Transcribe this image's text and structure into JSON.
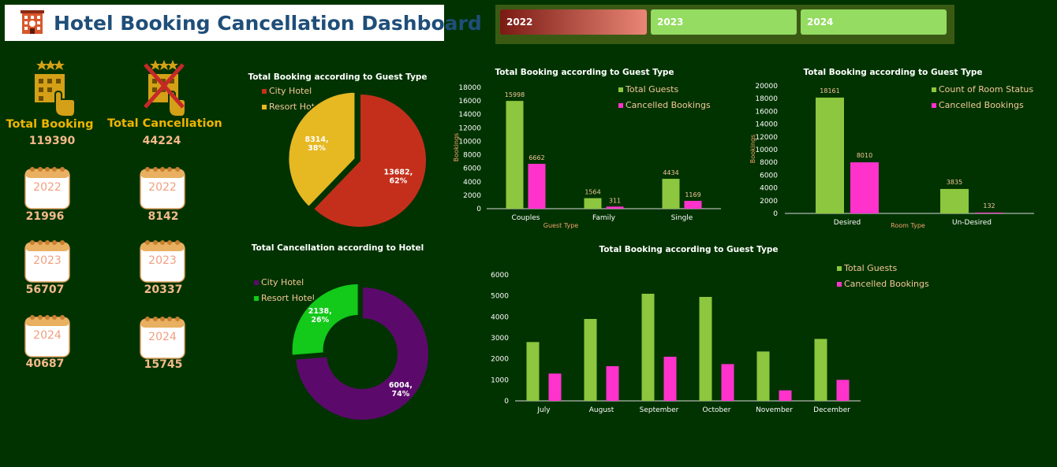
{
  "header": {
    "title": "Hotel Booking Cancellation Dashboard"
  },
  "slicer": {
    "years": [
      "2022",
      "2023",
      "2024"
    ],
    "selected": "2022"
  },
  "colors": {
    "background": "#013300",
    "accent_green": "#8dc63f",
    "accent_pink": "#ff33cc",
    "city_red": "#c42f1c",
    "resort_yellow": "#e6b822",
    "purple": "#5b0a6b",
    "bright_green": "#13c91a"
  },
  "kpi": {
    "total_booking": {
      "label": "Total Booking",
      "value": "119390",
      "icon": "hotel-building-icon"
    },
    "total_cancellation": {
      "label": "Total Cancellation",
      "value": "44224",
      "icon": "cancelled-hotel-icon"
    },
    "years": [
      {
        "year": "2022",
        "booking": "21996",
        "cancellation": "8142"
      },
      {
        "year": "2023",
        "booking": "56707",
        "cancellation": "20337"
      },
      {
        "year": "2024",
        "booking": "40687",
        "cancellation": "15745"
      }
    ]
  },
  "chart_data": [
    {
      "id": "pie-hotel",
      "type": "pie",
      "title": "Total Booking according to Guest Type",
      "labels": [
        "City Hotel",
        "Resort Hotel"
      ],
      "values": [
        13682,
        8314
      ],
      "data_labels": [
        "13682,\n62%",
        "8314,\n38%"
      ],
      "legend": "top-left"
    },
    {
      "id": "donut-cancel",
      "type": "pie",
      "title": "Total Cancellation according to Hotel",
      "labels": [
        "City Hotel",
        "Resort Hotel"
      ],
      "values": [
        6004,
        2138
      ],
      "data_labels": [
        "6004,\n74%",
        "2138,\n26%"
      ],
      "legend": "top-left"
    },
    {
      "id": "bar-guest",
      "type": "bar",
      "title": "Total Booking according to Guest Type",
      "categories": [
        "Couples",
        "Family",
        "Single"
      ],
      "series": [
        {
          "name": "Total Guests",
          "values": [
            15998,
            1564,
            4434
          ]
        },
        {
          "name": "Cancelled Bookings",
          "values": [
            6662,
            311,
            1169
          ]
        }
      ],
      "xlabel": "Guest Type",
      "ylabel": "Bookings",
      "ylim": [
        0,
        18000
      ],
      "yticks": [
        0,
        2000,
        4000,
        6000,
        8000,
        10000,
        12000,
        14000,
        16000,
        18000
      ],
      "legend": "top-right",
      "grid": false
    },
    {
      "id": "bar-room",
      "type": "bar",
      "title": "Total Booking according to Guest Type",
      "categories": [
        "Desired",
        "Un-Desired"
      ],
      "series": [
        {
          "name": "Count of Room Status",
          "values": [
            18161,
            3835
          ]
        },
        {
          "name": "Cancelled Bookings",
          "values": [
            8010,
            132
          ]
        }
      ],
      "xlabel": "Room Type",
      "ylabel": "Bookings",
      "ylim": [
        0,
        20000
      ],
      "yticks": [
        0,
        2000,
        4000,
        6000,
        8000,
        10000,
        12000,
        14000,
        16000,
        18000,
        20000
      ],
      "legend": "top-right",
      "grid": false
    },
    {
      "id": "bar-month",
      "type": "bar",
      "title": "Total Booking according to Guest Type",
      "categories": [
        "July",
        "August",
        "September",
        "October",
        "November",
        "December"
      ],
      "series": [
        {
          "name": "Total Guests",
          "values": [
            2800,
            3900,
            5100,
            4950,
            2350,
            2950
          ]
        },
        {
          "name": "Cancelled Bookings",
          "values": [
            1300,
            1650,
            2100,
            1750,
            500,
            1000
          ]
        }
      ],
      "ylim": [
        0,
        6000
      ],
      "yticks": [
        0,
        1000,
        2000,
        3000,
        4000,
        5000,
        6000
      ],
      "legend": "top-right",
      "grid": false
    }
  ]
}
